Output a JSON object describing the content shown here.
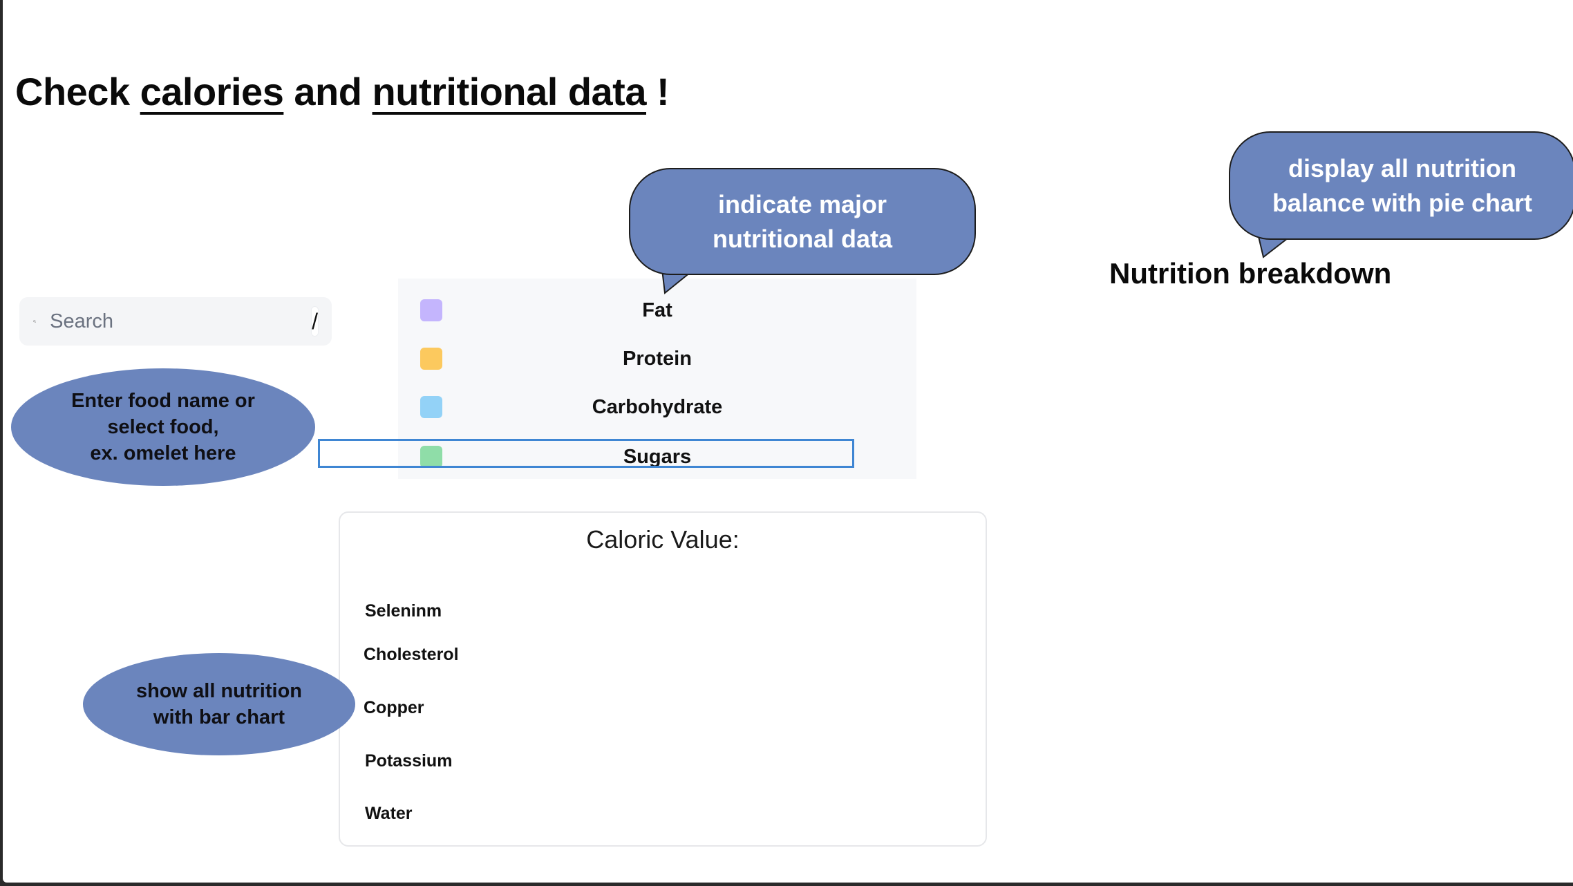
{
  "title": {
    "prefix": "Check ",
    "word1": "calories",
    "middle": " and ",
    "word2": "nutritional data",
    "suffix": " !"
  },
  "search": {
    "placeholder": "Search",
    "shortcut": "/"
  },
  "annotations": {
    "search_note": [
      "Enter food name or",
      "select food,",
      "ex. omelet here"
    ],
    "major_note": [
      "indicate major",
      "nutritional data"
    ],
    "pie_note": [
      "display all nutrition",
      "balance with pie chart"
    ],
    "bar_note": [
      "show all nutrition",
      "with bar chart"
    ]
  },
  "legend": {
    "items": [
      {
        "label": "Fat",
        "color": "#c4b5fd"
      },
      {
        "label": "Protein",
        "color": "#fcc95e"
      },
      {
        "label": "Carbohydrate",
        "color": "#93d2f7"
      },
      {
        "label": "Sugars",
        "color": "#8fdda8"
      }
    ]
  },
  "caloric": {
    "title": "Caloric Value:",
    "bars": [
      "Seleninm",
      "Cholesterol",
      "Copper",
      "Potassium",
      "Water"
    ]
  },
  "breakdown": {
    "heading": "Nutrition breakdown"
  },
  "colors": {
    "annotation": "#6b85bd",
    "highlight": "#3f86d3"
  }
}
